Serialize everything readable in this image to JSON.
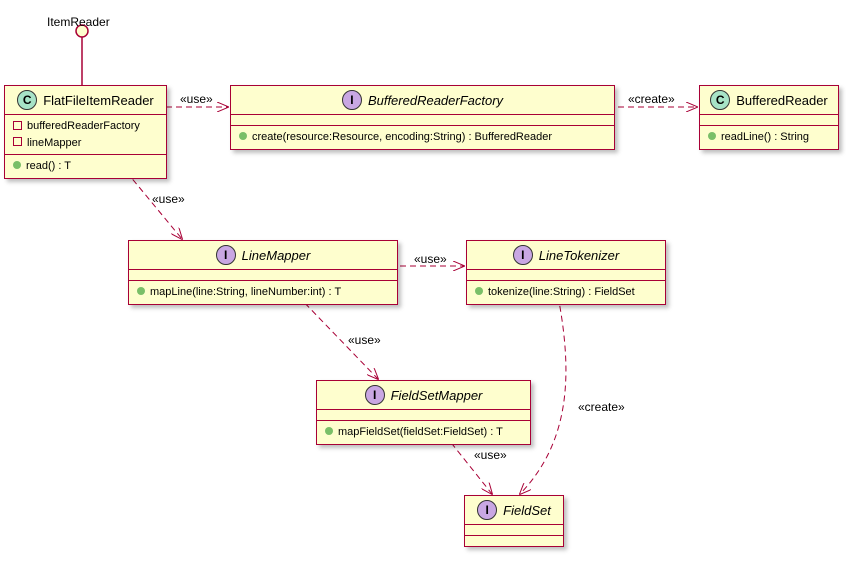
{
  "interface_port": {
    "name": "ItemReader"
  },
  "flatFileItemReader": {
    "title": "FlatFileItemReader",
    "st": "C",
    "fields": [
      "bufferedReaderFactory",
      "lineMapper"
    ],
    "methods": [
      "read() : T"
    ]
  },
  "bufferedReaderFactory": {
    "title": "BufferedReaderFactory",
    "st": "I",
    "methods": [
      "create(resource:Resource, encoding:String) : BufferedReader"
    ]
  },
  "bufferedReader": {
    "title": "BufferedReader",
    "st": "C",
    "methods": [
      "readLine() : String"
    ]
  },
  "lineMapper": {
    "title": "LineMapper",
    "st": "I",
    "methods": [
      "mapLine(line:String, lineNumber:int) : T"
    ]
  },
  "lineTokenizer": {
    "title": "LineTokenizer",
    "st": "I",
    "methods": [
      "tokenize(line:String) : FieldSet"
    ]
  },
  "fieldSetMapper": {
    "title": "FieldSetMapper",
    "st": "I",
    "methods": [
      "mapFieldSet(fieldSet:FieldSet) : T"
    ]
  },
  "fieldSet": {
    "title": "FieldSet",
    "st": "I"
  },
  "labels": {
    "use": "«use»",
    "create": "«create»"
  },
  "chart_data": {
    "type": "uml_class_diagram",
    "nodes": [
      {
        "id": "ItemReader",
        "kind": "interface_port"
      },
      {
        "id": "FlatFileItemReader",
        "kind": "class",
        "attributes": [
          "bufferedReaderFactory",
          "lineMapper"
        ],
        "operations": [
          "read() : T"
        ]
      },
      {
        "id": "BufferedReaderFactory",
        "kind": "interface",
        "operations": [
          "create(resource:Resource, encoding:String) : BufferedReader"
        ]
      },
      {
        "id": "BufferedReader",
        "kind": "class",
        "operations": [
          "readLine() : String"
        ]
      },
      {
        "id": "LineMapper",
        "kind": "interface",
        "operations": [
          "mapLine(line:String, lineNumber:int) : T"
        ]
      },
      {
        "id": "LineTokenizer",
        "kind": "interface",
        "operations": [
          "tokenize(line:String) : FieldSet"
        ]
      },
      {
        "id": "FieldSetMapper",
        "kind": "interface",
        "operations": [
          "mapFieldSet(fieldSet:FieldSet) : T"
        ]
      },
      {
        "id": "FieldSet",
        "kind": "interface"
      }
    ],
    "edges": [
      {
        "from": "FlatFileItemReader",
        "to": "ItemReader",
        "type": "realization_lollipop"
      },
      {
        "from": "FlatFileItemReader",
        "to": "BufferedReaderFactory",
        "type": "dependency",
        "label": "«use»"
      },
      {
        "from": "BufferedReaderFactory",
        "to": "BufferedReader",
        "type": "dependency",
        "label": "«create»"
      },
      {
        "from": "FlatFileItemReader",
        "to": "LineMapper",
        "type": "dependency",
        "label": "«use»"
      },
      {
        "from": "LineMapper",
        "to": "LineTokenizer",
        "type": "dependency",
        "label": "«use»"
      },
      {
        "from": "LineMapper",
        "to": "FieldSetMapper",
        "type": "dependency",
        "label": "«use»"
      },
      {
        "from": "LineTokenizer",
        "to": "FieldSet",
        "type": "dependency",
        "label": "«create»"
      },
      {
        "from": "FieldSetMapper",
        "to": "FieldSet",
        "type": "dependency",
        "label": "«use»"
      }
    ]
  }
}
